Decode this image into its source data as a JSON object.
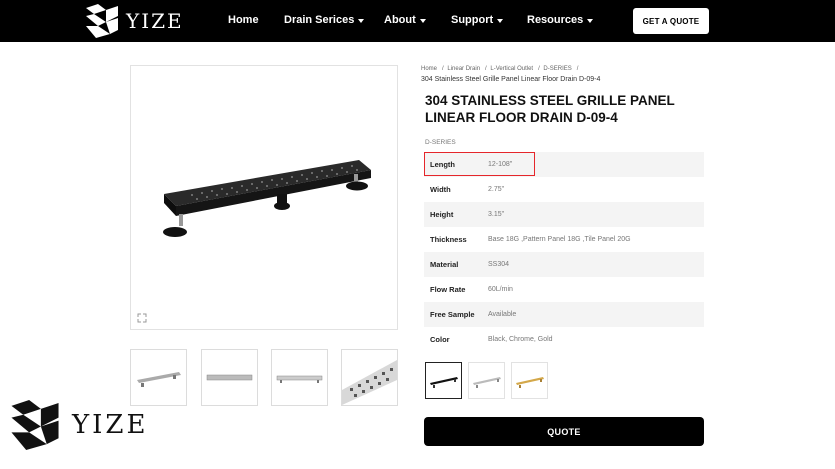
{
  "header": {
    "logo_text": "YIZE",
    "nav": [
      {
        "label": "Home",
        "has_dropdown": false
      },
      {
        "label": "Drain Serices",
        "has_dropdown": true
      },
      {
        "label": "About",
        "has_dropdown": true
      },
      {
        "label": "Support",
        "has_dropdown": true
      },
      {
        "label": "Resources",
        "has_dropdown": true
      }
    ],
    "cta_label": "GET A QUOTE"
  },
  "breadcrumb": {
    "items": [
      "Home",
      "Linear Drain",
      "L-Vertical Outlet",
      "D-SERIES"
    ],
    "current": "304 Stainless Steel Grille Panel Linear Floor Drain D-09-4"
  },
  "product": {
    "title": "304 STAINLESS STEEL GRILLE PANEL LINEAR FLOOR DRAIN D-09-4",
    "series": "D-SERIES",
    "specs": [
      {
        "label": "Length",
        "value": "12-108\""
      },
      {
        "label": "Width",
        "value": "2.75\""
      },
      {
        "label": "Height",
        "value": "3.15\""
      },
      {
        "label": "Thickness",
        "value": "Base 18G ,Pattern Panel 18G ,Tile Panel 20G"
      },
      {
        "label": "Material",
        "value": "SS304"
      },
      {
        "label": "Flow Rate",
        "value": "60L/min"
      },
      {
        "label": "Free Sample",
        "value": "Available"
      },
      {
        "label": "Color",
        "value": "Black, Chrome, Gold"
      }
    ],
    "swatches": [
      "black",
      "chrome",
      "gold"
    ],
    "quote_label": "QUOTE"
  },
  "footer_logo_text": "YIZE",
  "colors": {
    "header_bg": "#000000",
    "highlight_border": "#e5262b",
    "row_shade": "#f4f4f4",
    "button_bg": "#000000"
  }
}
